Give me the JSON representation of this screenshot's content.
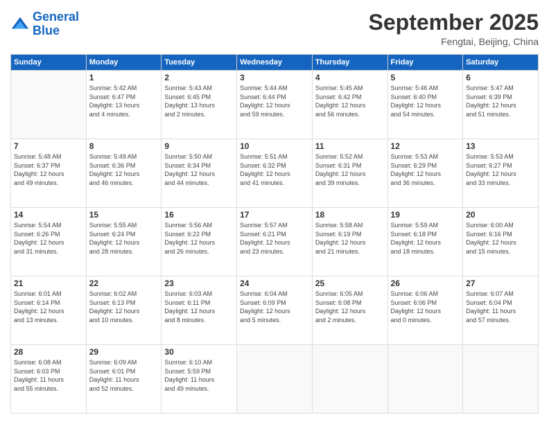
{
  "header": {
    "logo_line1": "General",
    "logo_line2": "Blue",
    "month": "September 2025",
    "location": "Fengtai, Beijing, China"
  },
  "weekdays": [
    "Sunday",
    "Monday",
    "Tuesday",
    "Wednesday",
    "Thursday",
    "Friday",
    "Saturday"
  ],
  "weeks": [
    [
      {
        "day": "",
        "info": ""
      },
      {
        "day": "1",
        "info": "Sunrise: 5:42 AM\nSunset: 6:47 PM\nDaylight: 13 hours\nand 4 minutes."
      },
      {
        "day": "2",
        "info": "Sunrise: 5:43 AM\nSunset: 6:45 PM\nDaylight: 13 hours\nand 2 minutes."
      },
      {
        "day": "3",
        "info": "Sunrise: 5:44 AM\nSunset: 6:44 PM\nDaylight: 12 hours\nand 59 minutes."
      },
      {
        "day": "4",
        "info": "Sunrise: 5:45 AM\nSunset: 6:42 PM\nDaylight: 12 hours\nand 56 minutes."
      },
      {
        "day": "5",
        "info": "Sunrise: 5:46 AM\nSunset: 6:40 PM\nDaylight: 12 hours\nand 54 minutes."
      },
      {
        "day": "6",
        "info": "Sunrise: 5:47 AM\nSunset: 6:39 PM\nDaylight: 12 hours\nand 51 minutes."
      }
    ],
    [
      {
        "day": "7",
        "info": "Sunrise: 5:48 AM\nSunset: 6:37 PM\nDaylight: 12 hours\nand 49 minutes."
      },
      {
        "day": "8",
        "info": "Sunrise: 5:49 AM\nSunset: 6:36 PM\nDaylight: 12 hours\nand 46 minutes."
      },
      {
        "day": "9",
        "info": "Sunrise: 5:50 AM\nSunset: 6:34 PM\nDaylight: 12 hours\nand 44 minutes."
      },
      {
        "day": "10",
        "info": "Sunrise: 5:51 AM\nSunset: 6:32 PM\nDaylight: 12 hours\nand 41 minutes."
      },
      {
        "day": "11",
        "info": "Sunrise: 5:52 AM\nSunset: 6:31 PM\nDaylight: 12 hours\nand 39 minutes."
      },
      {
        "day": "12",
        "info": "Sunrise: 5:53 AM\nSunset: 6:29 PM\nDaylight: 12 hours\nand 36 minutes."
      },
      {
        "day": "13",
        "info": "Sunrise: 5:53 AM\nSunset: 6:27 PM\nDaylight: 12 hours\nand 33 minutes."
      }
    ],
    [
      {
        "day": "14",
        "info": "Sunrise: 5:54 AM\nSunset: 6:26 PM\nDaylight: 12 hours\nand 31 minutes."
      },
      {
        "day": "15",
        "info": "Sunrise: 5:55 AM\nSunset: 6:24 PM\nDaylight: 12 hours\nand 28 minutes."
      },
      {
        "day": "16",
        "info": "Sunrise: 5:56 AM\nSunset: 6:22 PM\nDaylight: 12 hours\nand 26 minutes."
      },
      {
        "day": "17",
        "info": "Sunrise: 5:57 AM\nSunset: 6:21 PM\nDaylight: 12 hours\nand 23 minutes."
      },
      {
        "day": "18",
        "info": "Sunrise: 5:58 AM\nSunset: 6:19 PM\nDaylight: 12 hours\nand 21 minutes."
      },
      {
        "day": "19",
        "info": "Sunrise: 5:59 AM\nSunset: 6:18 PM\nDaylight: 12 hours\nand 18 minutes."
      },
      {
        "day": "20",
        "info": "Sunrise: 6:00 AM\nSunset: 6:16 PM\nDaylight: 12 hours\nand 15 minutes."
      }
    ],
    [
      {
        "day": "21",
        "info": "Sunrise: 6:01 AM\nSunset: 6:14 PM\nDaylight: 12 hours\nand 13 minutes."
      },
      {
        "day": "22",
        "info": "Sunrise: 6:02 AM\nSunset: 6:13 PM\nDaylight: 12 hours\nand 10 minutes."
      },
      {
        "day": "23",
        "info": "Sunrise: 6:03 AM\nSunset: 6:11 PM\nDaylight: 12 hours\nand 8 minutes."
      },
      {
        "day": "24",
        "info": "Sunrise: 6:04 AM\nSunset: 6:09 PM\nDaylight: 12 hours\nand 5 minutes."
      },
      {
        "day": "25",
        "info": "Sunrise: 6:05 AM\nSunset: 6:08 PM\nDaylight: 12 hours\nand 2 minutes."
      },
      {
        "day": "26",
        "info": "Sunrise: 6:06 AM\nSunset: 6:06 PM\nDaylight: 12 hours\nand 0 minutes."
      },
      {
        "day": "27",
        "info": "Sunrise: 6:07 AM\nSunset: 6:04 PM\nDaylight: 11 hours\nand 57 minutes."
      }
    ],
    [
      {
        "day": "28",
        "info": "Sunrise: 6:08 AM\nSunset: 6:03 PM\nDaylight: 11 hours\nand 55 minutes."
      },
      {
        "day": "29",
        "info": "Sunrise: 6:09 AM\nSunset: 6:01 PM\nDaylight: 11 hours\nand 52 minutes."
      },
      {
        "day": "30",
        "info": "Sunrise: 6:10 AM\nSunset: 5:59 PM\nDaylight: 11 hours\nand 49 minutes."
      },
      {
        "day": "",
        "info": ""
      },
      {
        "day": "",
        "info": ""
      },
      {
        "day": "",
        "info": ""
      },
      {
        "day": "",
        "info": ""
      }
    ]
  ]
}
